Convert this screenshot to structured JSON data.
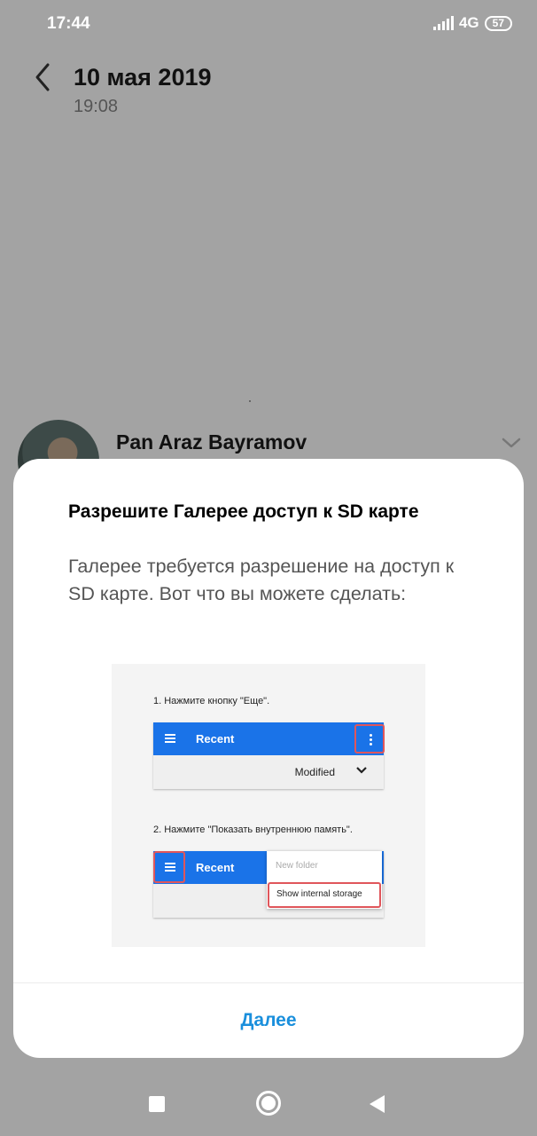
{
  "status_bar": {
    "time": "17:44",
    "network": "4G",
    "battery": "57"
  },
  "header": {
    "date": "10 мая 2019",
    "time": "19:08"
  },
  "sender": {
    "name": "Pan Araz Bayramov"
  },
  "dialog": {
    "title": "Разрешите Галерее доступ к SD карте",
    "body": "Галерее требуется разрешение на доступ к SD карте. Вот что вы можете сделать:",
    "illustration": {
      "step1": "1. Нажмите кнопку \"Еще\".",
      "step2": "2. Нажмите \"Показать внутреннюю память\".",
      "appbar_title": "Recent",
      "sort_label": "Modified",
      "menu_item_new_folder": "New folder",
      "menu_item_show_storage": "Show internal storage"
    },
    "button_next": "Далее"
  },
  "colors": {
    "accent": "#1a8fdc",
    "appbar_blue": "#1a73e8",
    "highlight_red": "#e0565b",
    "scrim": "#a3a3a3"
  }
}
